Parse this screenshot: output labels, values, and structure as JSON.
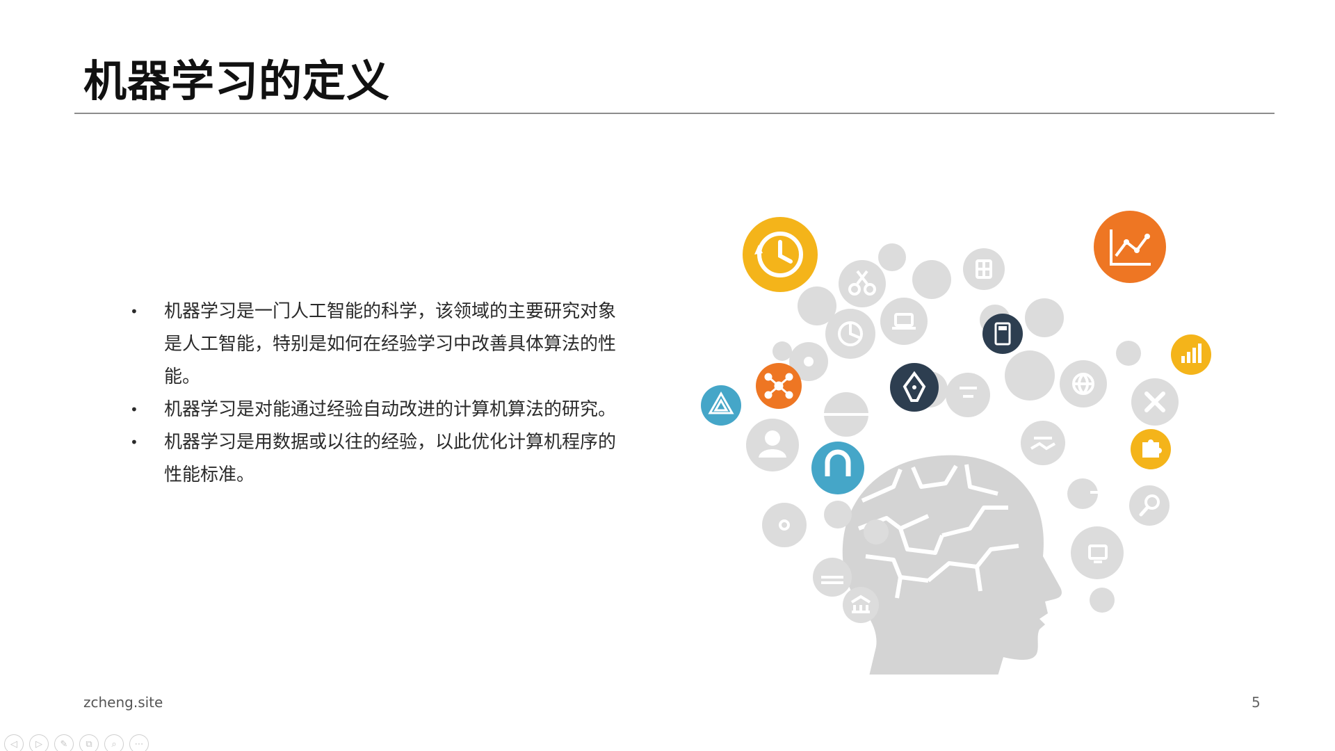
{
  "slide": {
    "title": "机器学习的定义",
    "bullets": [
      "机器学习是一门人工智能的科学，该领域的主要研究对象是人工智能，特别是如何在经验学习中改善具体算法的性能。",
      "机器学习是对能通过经验自动改进的计算机算法的研究。",
      "机器学习是用数据或以往的经验，以此优化计算机程序的性能标准。"
    ],
    "bullet_marker": "•",
    "footer": "zcheng.site",
    "page_number": "5"
  },
  "colors": {
    "accent_yellow": "#f4b41a",
    "accent_orange": "#ee7623",
    "accent_blue": "#45a6c8",
    "accent_navy": "#2d3e50",
    "icon_gray": "#dcdcdc",
    "head_gray": "#d4d4d4"
  },
  "toolbar": {
    "buttons": [
      {
        "name": "previous-slide-button",
        "icon": "arrow-left-icon",
        "glyph": "◁"
      },
      {
        "name": "next-slide-button",
        "icon": "arrow-right-icon",
        "glyph": "▷"
      },
      {
        "name": "pen-tool-button",
        "icon": "pen-icon",
        "glyph": "✎"
      },
      {
        "name": "slides-overview-button",
        "icon": "slides-icon",
        "glyph": "⧉"
      },
      {
        "name": "zoom-button",
        "icon": "magnifier-icon",
        "glyph": "⌕"
      },
      {
        "name": "more-options-button",
        "icon": "more-icon",
        "glyph": "⋯"
      }
    ]
  }
}
